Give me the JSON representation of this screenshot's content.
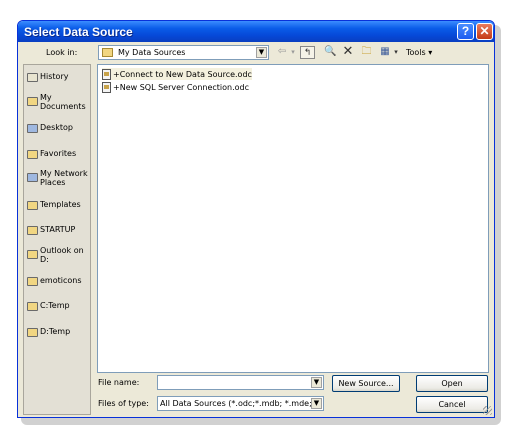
{
  "window": {
    "title": "Select Data Source"
  },
  "lookin": {
    "label": "Look in:",
    "value": "My Data Sources"
  },
  "toolbar": {
    "tools_label": "Tools"
  },
  "places": [
    {
      "label": "History"
    },
    {
      "label": "My Documents"
    },
    {
      "label": "Desktop"
    },
    {
      "label": "Favorites"
    },
    {
      "label": "My Network Places"
    },
    {
      "label": "Templates"
    },
    {
      "label": "STARTUP"
    },
    {
      "label": "Outlook on D:"
    },
    {
      "label": "emoticons"
    },
    {
      "label": "C:Temp"
    },
    {
      "label": "D:Temp"
    }
  ],
  "files": [
    {
      "name": "+Connect to New Data Source.odc"
    },
    {
      "name": "+New SQL Server Connection.odc"
    }
  ],
  "filename": {
    "label": "File name:",
    "value": ""
  },
  "filetype": {
    "label": "Files of type:",
    "value": "All Data Sources (*.odc;*.mdb; *.mde;"
  },
  "buttons": {
    "new_source": "New Source...",
    "open": "Open",
    "cancel": "Cancel"
  },
  "colors": {
    "title_bar": "#0a5ce8",
    "window_bg": "#ece9d8",
    "close_button": "#c43a16"
  }
}
